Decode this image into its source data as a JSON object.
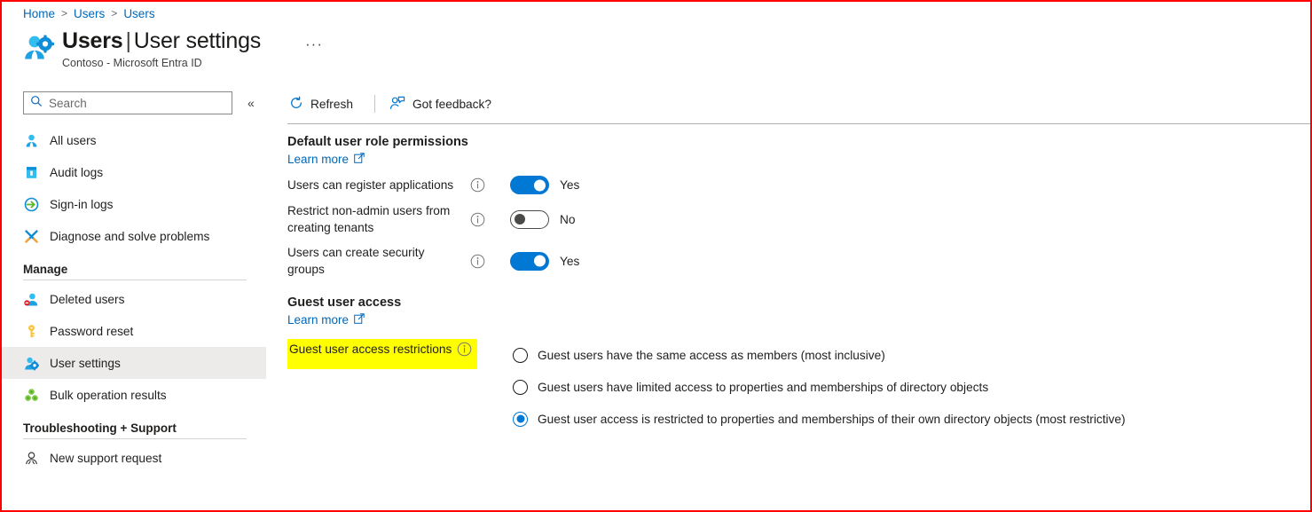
{
  "breadcrumb": {
    "items": [
      "Home",
      "Users",
      "Users"
    ],
    "separator": ">"
  },
  "header": {
    "icon": "users-settings-icon",
    "title_main": "Users",
    "title_divider": "|",
    "title_sub": "User settings",
    "subtitle": "Contoso - Microsoft Entra ID",
    "more_label": "···"
  },
  "search": {
    "placeholder": "Search",
    "value": "",
    "icon": "search-icon",
    "collapse_icon": "«"
  },
  "sidebar": {
    "items": [
      {
        "label": "All users",
        "icon": "user-icon",
        "selected": false
      },
      {
        "label": "Audit logs",
        "icon": "book-icon",
        "selected": false
      },
      {
        "label": "Sign-in logs",
        "icon": "sign-in-arrow-icon",
        "selected": false
      },
      {
        "label": "Diagnose and solve problems",
        "icon": "wrench-screwdriver-icon",
        "selected": false
      }
    ],
    "groups": [
      {
        "title": "Manage",
        "items": [
          {
            "label": "Deleted users",
            "icon": "user-delete-icon",
            "selected": false
          },
          {
            "label": "Password reset",
            "icon": "key-icon",
            "selected": false
          },
          {
            "label": "User settings",
            "icon": "user-gear-icon",
            "selected": true
          },
          {
            "label": "Bulk operation results",
            "icon": "bulk-clover-icon",
            "selected": false
          }
        ]
      },
      {
        "title": "Troubleshooting + Support",
        "items": [
          {
            "label": "New support request",
            "icon": "support-person-icon",
            "selected": false
          }
        ]
      }
    ]
  },
  "toolbar": {
    "refresh_label": "Refresh",
    "refresh_icon": "refresh-icon",
    "feedback_label": "Got feedback?",
    "feedback_icon": "feedback-person-icon"
  },
  "main": {
    "default_permissions": {
      "heading": "Default user role permissions",
      "learn_more": "Learn more",
      "learn_more_icon": "external-link-icon",
      "settings": [
        {
          "label": "Users can register applications",
          "state": "Yes",
          "on": true
        },
        {
          "label": "Restrict non-admin users from creating tenants",
          "state": "No",
          "on": false
        },
        {
          "label": "Users can create security groups",
          "state": "Yes",
          "on": true
        }
      ]
    },
    "guest_access": {
      "heading": "Guest user access",
      "learn_more": "Learn more",
      "learn_more_icon": "external-link-icon",
      "restrictions_label": "Guest user access restrictions",
      "restrictions_highlight_color": "#ffff00",
      "options": [
        {
          "label": "Guest users have the same access as members (most inclusive)",
          "selected": false
        },
        {
          "label": "Guest users have limited access to properties and memberships of directory objects",
          "selected": false
        },
        {
          "label": "Guest user access is restricted to properties and memberships of their own directory objects (most restrictive)",
          "selected": true
        }
      ]
    }
  },
  "colors": {
    "accent": "#0078d4",
    "link": "#0067b8",
    "highlight": "#ffff00",
    "selected_row": "#edebe9",
    "screenshot_border": "#ff0000"
  }
}
